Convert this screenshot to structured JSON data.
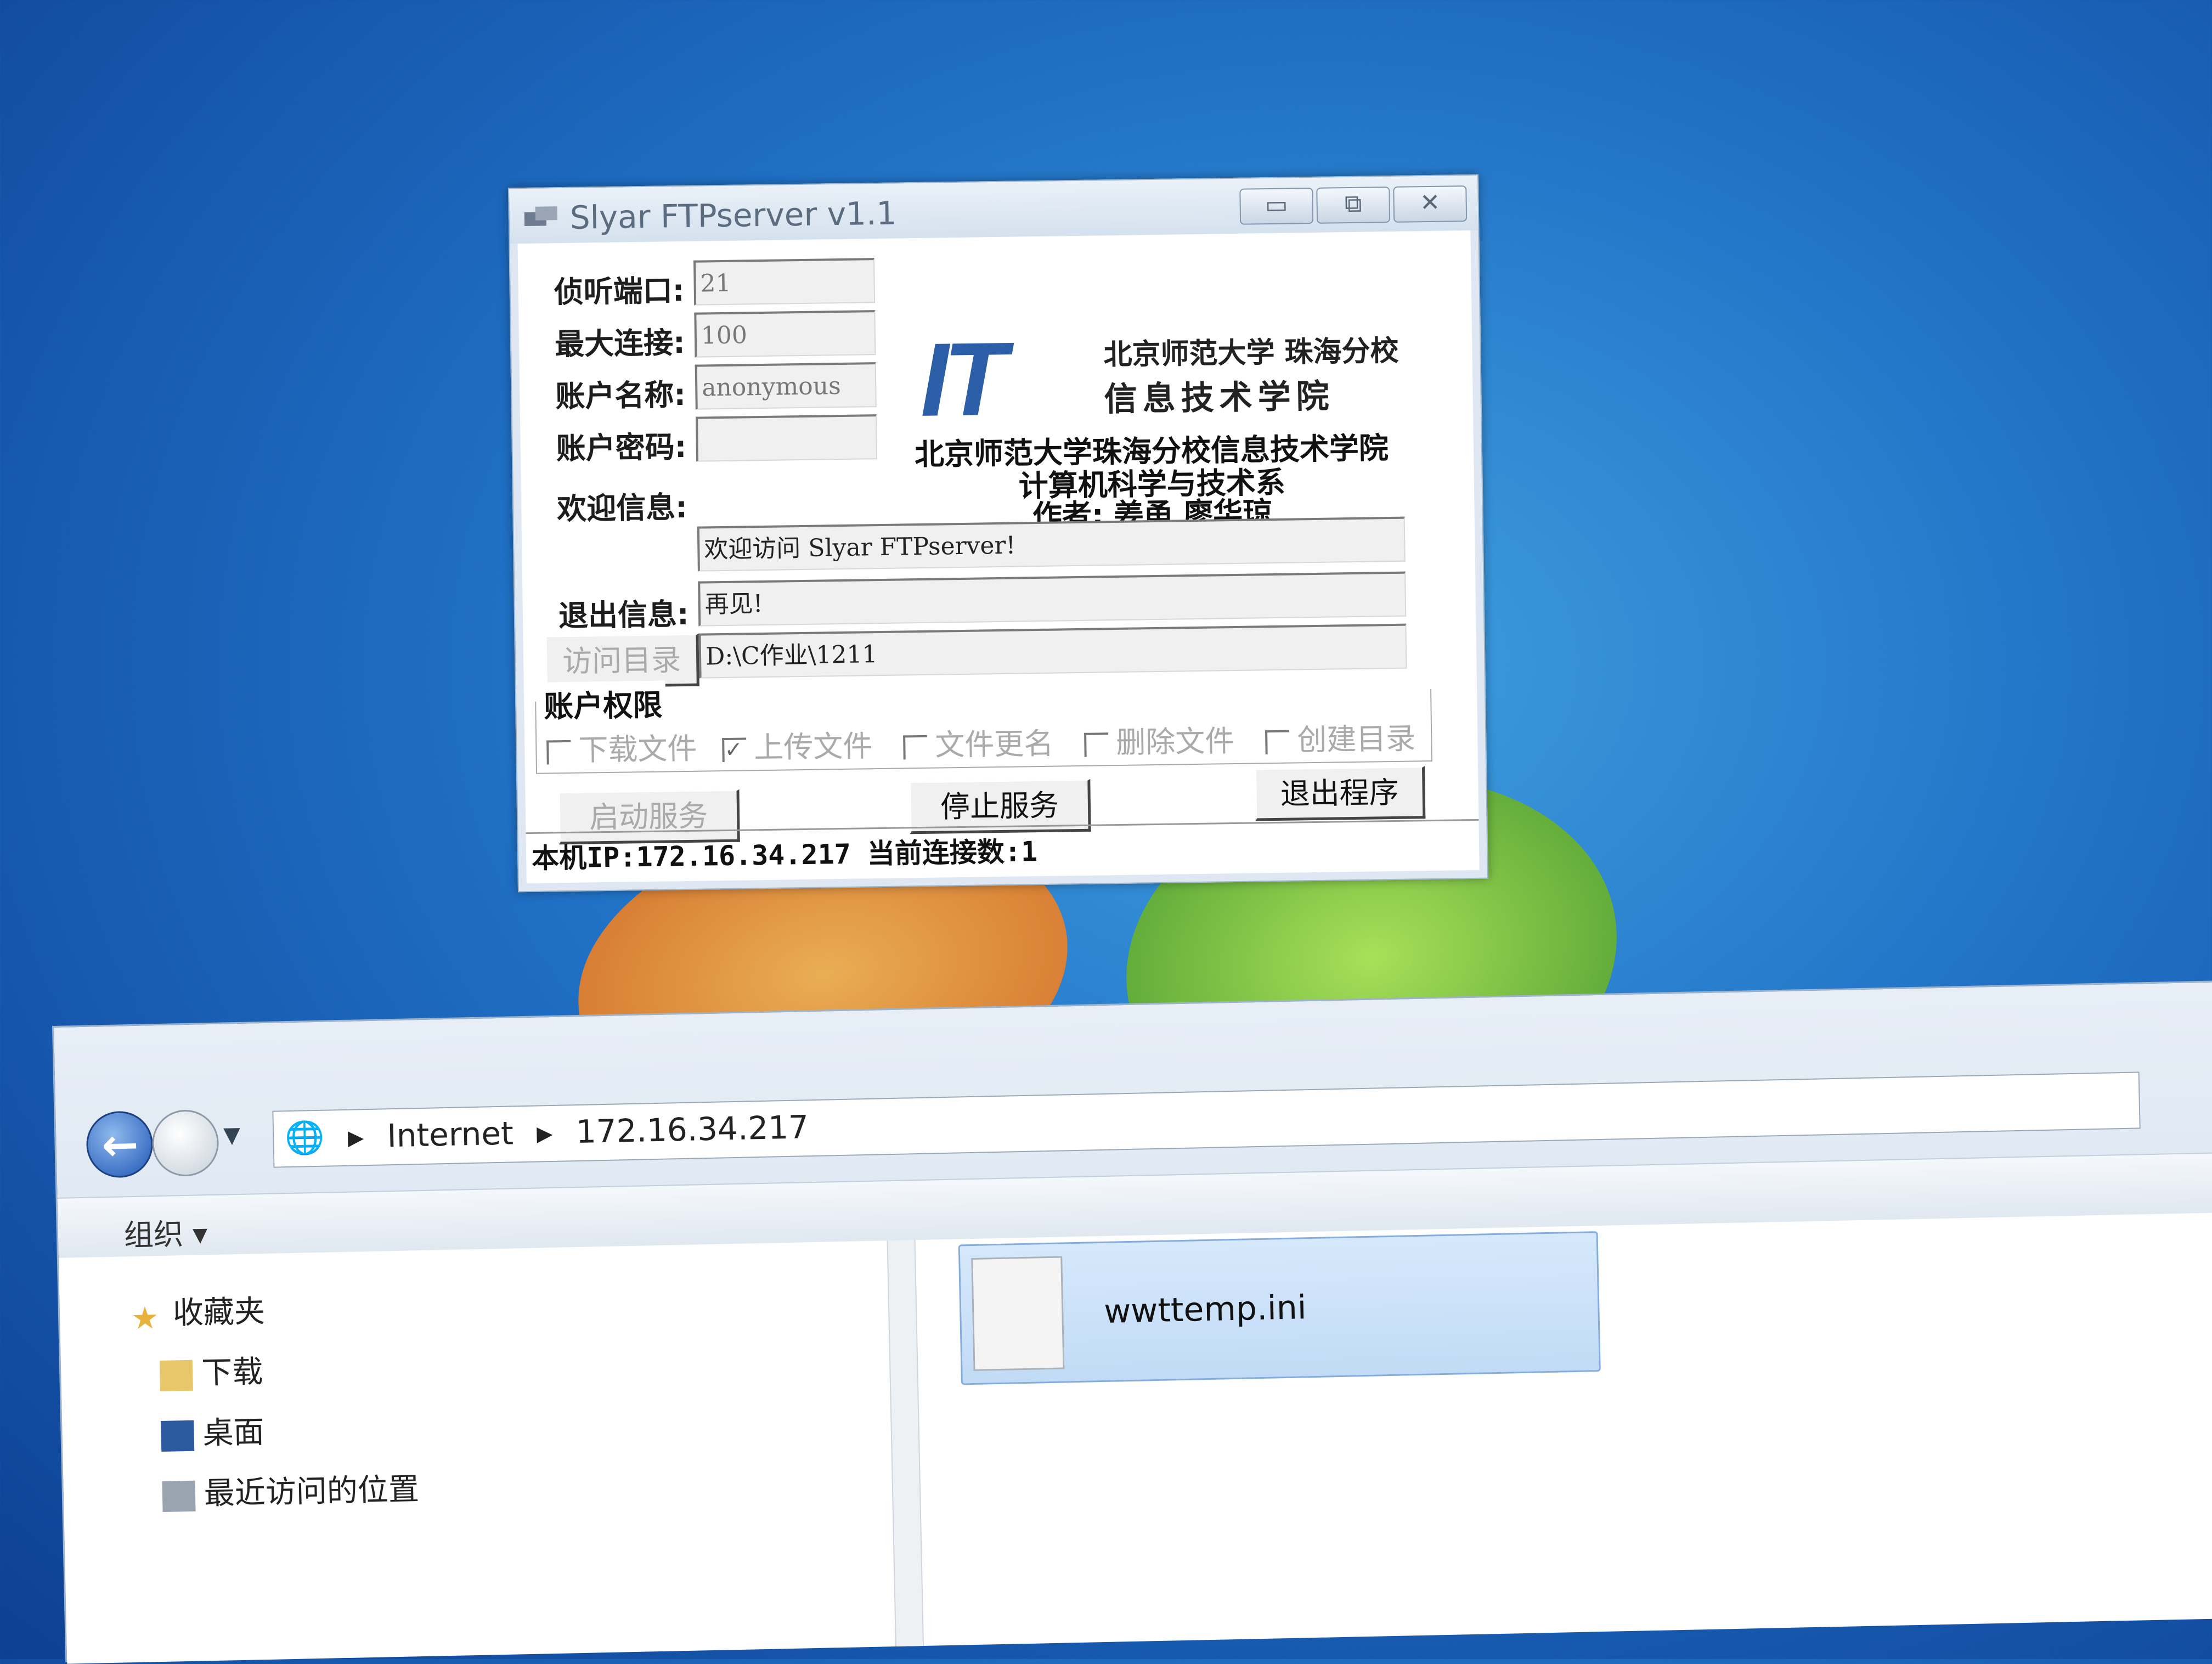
{
  "ftp_dialog": {
    "title": "Slyar FTPserver v1.1",
    "buttons": {
      "minimize": "▭",
      "maximize": "⧉",
      "close": "✕"
    },
    "labels": {
      "port": "侦听端口:",
      "max_conn": "最大连接:",
      "account": "账户名称:",
      "password": "账户密码:",
      "welcome": "欢迎信息:",
      "exit": "退出信息:"
    },
    "values": {
      "port": "21",
      "max_conn": "100",
      "account": "anonymous",
      "password": "",
      "welcome": "欢迎访问 Slyar FTPserver!",
      "exit": "再见!",
      "directory": "D:\\C作业\\1211"
    },
    "directory_button": "访问目录",
    "logo": {
      "it": "IT",
      "school_line1": "北京师范大学 珠海分校",
      "school_line2": "信息技术学院"
    },
    "info": {
      "line1": "北京师范大学珠海分校信息技术学院",
      "line2": "计算机科学与技术系",
      "line3": "作者: 姜甬  廖华琼"
    },
    "permissions": {
      "title": "账户权限",
      "items": [
        {
          "label": "下载文件",
          "checked": false
        },
        {
          "label": "上传文件",
          "checked": true
        },
        {
          "label": "文件更名",
          "checked": false
        },
        {
          "label": "删除文件",
          "checked": false
        },
        {
          "label": "创建目录",
          "checked": false
        }
      ]
    },
    "actions": {
      "start": "启动服务",
      "stop": "停止服务",
      "quit": "退出程序"
    },
    "status": "本机IP:172.16.34.217  当前连接数:1"
  },
  "explorer": {
    "breadcrumb": [
      "Internet",
      "172.16.34.217"
    ],
    "toolbar": {
      "organize": "组织 ▾"
    },
    "nav_items": [
      "收藏夹",
      "下载",
      "桌面",
      "最近访问的位置"
    ],
    "file": {
      "name": "wwttemp.ini"
    }
  },
  "colors": {
    "desktop": "#1f6fc4",
    "it_logo": "#2d5fa8",
    "selection": "#c1dbf6"
  }
}
